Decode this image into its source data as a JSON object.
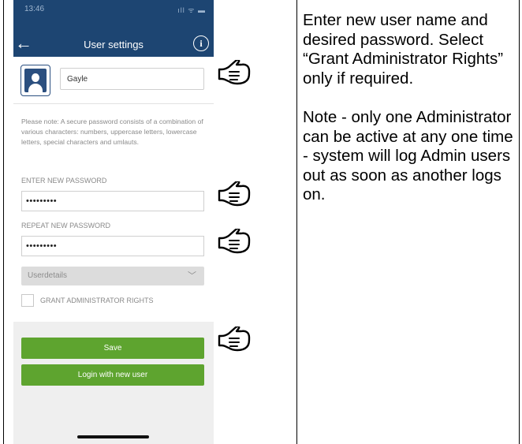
{
  "status_bar": {
    "time": "13:46",
    "icons": "ıll ᯤ ▬"
  },
  "nav": {
    "back": "←",
    "title": "User settings",
    "info": "i"
  },
  "user": {
    "name": "Gayle"
  },
  "note": "Please note: A secure password consists of a combination of various characters: numbers, uppercase letters, lowercase letters, special characters and umlauts.",
  "password": {
    "enter_label": "ENTER NEW PASSWORD",
    "enter_value": "•••••••••",
    "repeat_label": "REPEAT NEW PASSWORD",
    "repeat_value": "•••••••••"
  },
  "userdetails": {
    "label": "Userdetails",
    "chevron": "﹀"
  },
  "admin_checkbox": {
    "label": "GRANT ADMINISTRATOR RIGHTS",
    "checked": false
  },
  "buttons": {
    "save": "Save",
    "login": "Login with new user"
  },
  "instructions": {
    "paragraph1": "Enter new user name and desired password. Select “Grant Administrator Rights” only if required.",
    "paragraph2": "Note - only one Administrator can be active at any one time - system will log Admin users out as soon as another logs on."
  },
  "icons": [
    "back-arrow-icon",
    "info-icon",
    "user-avatar-icon",
    "pointing-hand-icon",
    "chevron-down-icon"
  ],
  "colors": {
    "header": "#1d4572",
    "button": "#5ea42f",
    "field_border": "#cfcfcf"
  }
}
